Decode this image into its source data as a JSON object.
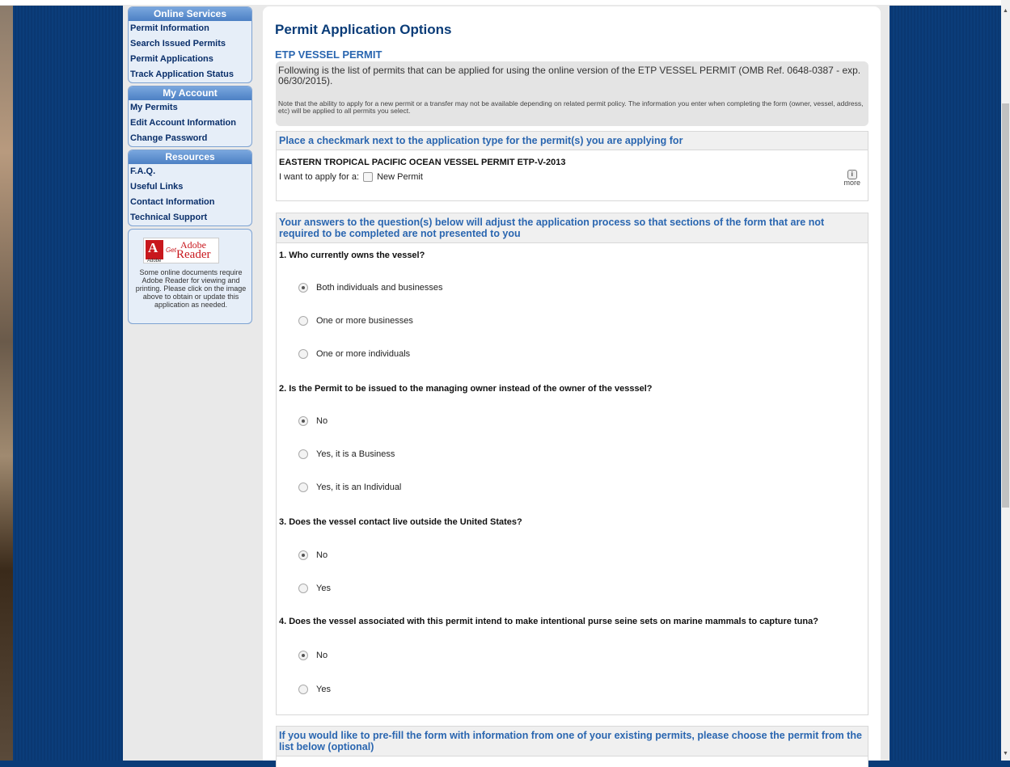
{
  "sidebar": {
    "online_services": {
      "title": "Online Services",
      "items": [
        "Permit Information",
        "Search Issued Permits",
        "Permit Applications",
        "Track Application Status"
      ]
    },
    "my_account": {
      "title": "My Account",
      "items": [
        "My Permits",
        "Edit Account Information",
        "Change Password"
      ]
    },
    "resources": {
      "title": "Resources",
      "items": [
        "F.A.Q.",
        "Useful Links",
        "Contact Information",
        "Technical Support"
      ]
    },
    "adobe": {
      "logo_a": "A",
      "logo_label": "Adobe",
      "get": "Get",
      "adobe": "Adobe",
      "reader": "Reader",
      "text": "Some online documents require Adobe Reader for viewing and printing. Please click on the image above to obtain or update this application as needed."
    }
  },
  "main": {
    "title": "Permit Application Options",
    "section_title": "ETP VESSEL PERMIT",
    "intro": "Following is the list of permits that can be applied for using the online version of the ETP VESSEL PERMIT (OMB Ref. 0648-0387 - exp. 06/30/2015).",
    "note": "Note that the ability to apply for a new permit or a transfer may not be available depending on related permit policy. The information you enter when completing the form (owner, vessel, address, etc) will be applied to all permits you select.",
    "checkmark_panel": {
      "heading": "Place a checkmark next to the application type for the permit(s) you are applying for",
      "permit_name": "EASTERN TROPICAL PACIFIC OCEAN VESSEL PERMIT ETP-V-2013",
      "apply_label": "I want to apply for a:",
      "new_permit_label": "New Permit",
      "more_icon": "i",
      "more_label": "more"
    },
    "questions_panel": {
      "heading": "Your answers to the question(s) below will adjust the application process so that sections of the form that are not required to be completed are not presented to you",
      "questions": [
        {
          "title": "1. Who currently owns the vessel?",
          "options": [
            "Both individuals and businesses",
            "One or more businesses",
            "One or more individuals"
          ]
        },
        {
          "title": "2. Is the Permit to be issued to the managing owner instead of the owner of the vesssel?",
          "options": [
            "No",
            "Yes, it is a Business",
            "Yes, it is an Individual"
          ]
        },
        {
          "title": "3. Does the vessel contact live outside the United States?",
          "options": [
            "No",
            "Yes"
          ]
        },
        {
          "title": "4. Does the vessel associated with this permit intend to make intentional purse seine sets on marine mammals to capture tuna?",
          "options": [
            "No",
            "Yes"
          ]
        }
      ]
    },
    "prefill_panel": {
      "heading": "If you would like to pre-fill the form with information from one of your existing permits, please choose the permit from the list below (optional)"
    }
  },
  "colors": {
    "accent": "#2a66b0",
    "nav_text": "#0a2f6a",
    "background": "#0a3c78"
  },
  "scrollbar": {
    "up_arrow": "▲",
    "down_arrow": "▼"
  }
}
